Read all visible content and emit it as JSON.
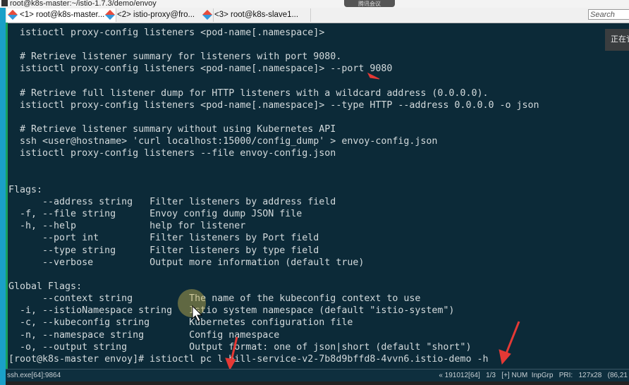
{
  "window": {
    "title": "root@k8s-master:~/istio-1.7.3/demo/envoy",
    "meeting_badge": "腾讯会议"
  },
  "tabs": [
    {
      "label": "<1> root@k8s-master...",
      "active": true
    },
    {
      "label": "<2> istio-proxy@fro...",
      "active": false
    },
    {
      "label": "<3> root@k8s-slave1...",
      "active": false
    }
  ],
  "search": {
    "placeholder": "Search"
  },
  "overlay_text": "正在讠",
  "terminal": {
    "lines": [
      "  istioctl proxy-config listeners <pod-name[.namespace]>",
      "",
      "  # Retrieve listener summary for listeners with port 9080.",
      "  istioctl proxy-config listeners <pod-name[.namespace]> --port 9080",
      "",
      "  # Retrieve full listener dump for HTTP listeners with a wildcard address (0.0.0.0).",
      "  istioctl proxy-config listeners <pod-name[.namespace]> --type HTTP --address 0.0.0.0 -o json",
      "",
      "  # Retrieve listener summary without using Kubernetes API",
      "  ssh <user@hostname> 'curl localhost:15000/config_dump' > envoy-config.json",
      "  istioctl proxy-config listeners --file envoy-config.json",
      "",
      "",
      "Flags:",
      "      --address string   Filter listeners by address field",
      "  -f, --file string      Envoy config dump JSON file",
      "  -h, --help             help for listener",
      "      --port int         Filter listeners by Port field",
      "      --type string      Filter listeners by type field",
      "      --verbose          Output more information (default true)",
      "",
      "Global Flags:",
      "      --context string          The name of the kubeconfig context to use",
      "  -i, --istioNamespace string   Istio system namespace (default \"istio-system\")",
      "  -c, --kubeconfig string       Kubernetes configuration file",
      "  -n, --namespace string        Config namespace",
      "  -o, --output string           Output format: one of json|short (default \"short\")",
      "[root@k8s-master envoy]# istioctl pc l bill-service-v2-7b8d9bffd8-4vvn6.istio-demo -h"
    ]
  },
  "statusbar": {
    "left": "ssh.exe[64]:9864",
    "right": "« 191012[64]   1/3   [+] NUM  InpGrp   PRI:   127x28   (86,21"
  },
  "colors": {
    "terminal_bg": "#0c2a38",
    "terminal_fg": "#d3dadc",
    "annotation_arrow": "#e53935"
  }
}
